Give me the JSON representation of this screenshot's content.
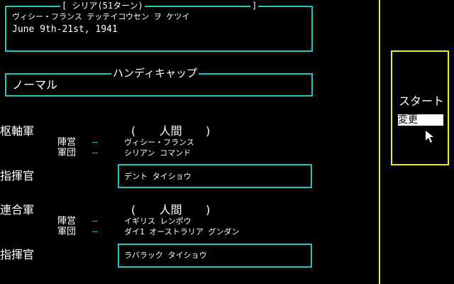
{
  "scenario": {
    "header": "[ シリア(51ターン)",
    "header_close": "]",
    "subtitle": "ヴィシー・フランス テッテイコウセン ヲ ケツイ",
    "date": "June 9th-21st, 1941"
  },
  "handicap": {
    "legend": "ハンディキャップ",
    "value": "ノーマル"
  },
  "axis": {
    "label": "枢軸軍",
    "player_type": "(　　人間　　)",
    "camp_label": "陣営",
    "corps_label": "軍団",
    "dash": "—",
    "camp_value": "ヴィシー・フランス",
    "corps_value": "シリアン コマンド",
    "commander_label": "指揮官",
    "commander_value": "デント タイショウ"
  },
  "allied": {
    "label": "連合軍",
    "player_type": "(　　人間　　)",
    "camp_label": "陣営",
    "corps_label": "軍団",
    "dash": "—",
    "camp_value": "イギリス レンポウ",
    "corps_value": "ダイ1 オーストラリア グンダン",
    "commander_label": "指揮官",
    "commander_value": "ラバラック タイショウ"
  },
  "menu": {
    "start_label": "スタート",
    "change_label": "変更"
  },
  "colors": {
    "frame": "#1fc4c4",
    "menu_frame": "#f0f000",
    "background": "#000000"
  },
  "icons": [
    "mouse-cursor-icon"
  ]
}
